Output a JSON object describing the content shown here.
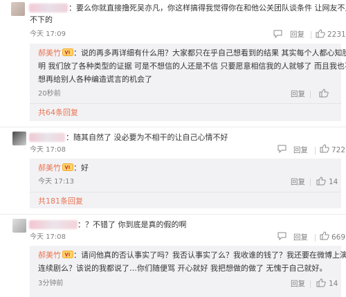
{
  "comments": [
    {
      "user_colon": "：",
      "text_line1": "要么你就直接撸死吴亦凡，你这样搞得我觉得你在和他公关团队谈条件 让网友不上",
      "text_line2": "不下的",
      "time": "今天 17:09",
      "reply_label": "回复",
      "like_count": "2231",
      "replies": [
        {
          "user": "郝美竹",
          "text_line1": "：说的再多再详细有什么用？大家都只在乎自己想看到的结果 其实每个人都心知肚",
          "text_line2": "明 我们放了各种类型的证据 可是不想信的人还是不信 只要愿意相信我的人就够了 而且我也不",
          "text_line3": "想再给别人各种编造谎言的机会了",
          "time": "20秒前",
          "reply_label": "回复",
          "like_label": ""
        }
      ],
      "more_replies": "共64条回复"
    },
    {
      "user_colon": "：",
      "text_line1": "随其自然了 没必要为不相干的让自己心情不好",
      "time": "今天 17:08",
      "reply_label": "回复",
      "like_count": "722",
      "replies": [
        {
          "user": "郝美竹",
          "text_line1": "：好",
          "time": "今天 17:13",
          "reply_label": "回复",
          "like_count": "14"
        }
      ],
      "more_replies": "共181条回复"
    },
    {
      "user_colon": "：",
      "text_line1": "？不错了 你到底是真的假的啊",
      "time": "今天 17:08",
      "reply_label": "回复",
      "like_count": "669",
      "replies": [
        {
          "user": "郝美竹",
          "text_line1": "：请问他真的否认事实了吗？我否认事实了么？我收谁的钱了？我还要在微博上演",
          "text_line2": "连续剧么？该说的我都说了…你们随便骂 开心就好 我把想做的做了 无愧于自己就好。",
          "time": "3分钟前",
          "reply_label": "回复",
          "like_count": "14"
        }
      ]
    }
  ],
  "icons": {
    "reply_icon": "reply-icon",
    "like_icon": "thumbs-up-icon",
    "vip_badge": "vip-badge-icon"
  },
  "colors": {
    "username": "#eb7350",
    "reply_bg": "#f2f2f5",
    "meta": "#808080"
  }
}
